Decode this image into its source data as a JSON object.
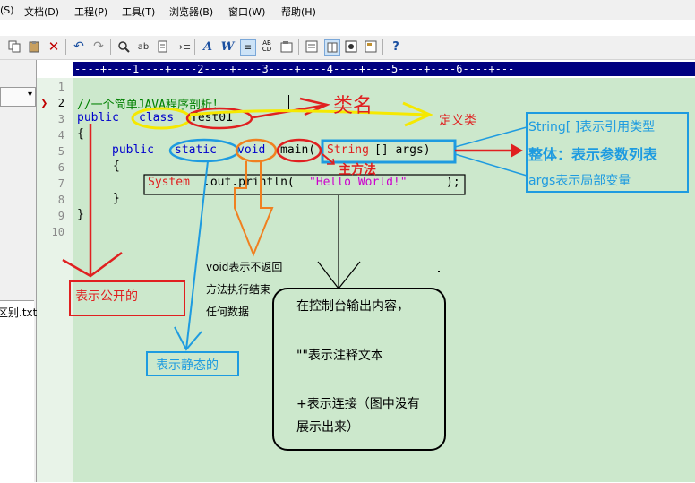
{
  "menu": {
    "items": [
      "(S)",
      "文档(D)",
      "工程(P)",
      "工具(T)",
      "浏览器(B)",
      "窗口(W)",
      "帮助(H)"
    ]
  },
  "toolbar": {
    "icons": [
      "copy-icon",
      "paste-icon",
      "delete-icon",
      "undo-icon",
      "redo-icon",
      "find-icon",
      "replace-icon",
      "find-in-files-icon",
      "indent-icon",
      "font-icon",
      "wordwrap-icon",
      "line-number-icon",
      "hex-icon",
      "settings-icon",
      "view-icon",
      "column-icon",
      "print-icon",
      "close-doc-icon",
      "help-icon"
    ]
  },
  "sidebar": {
    "file_item": "区别.txt"
  },
  "ruler": {
    "text": "----+----1----+----2----+----3----+----4----+----5----+----6----+---"
  },
  "editor": {
    "line_numbers": [
      "1",
      "2",
      "3",
      "4",
      "5",
      "6",
      "7",
      "8",
      "9",
      "10"
    ],
    "line2_comment": "//一个简单JAVA程序剖析！",
    "line3_public": "public",
    "line3_class": "class",
    "line3_name": "Test01",
    "line4": "{",
    "line5_public": "public",
    "line5_static": "static",
    "line5_void": "void",
    "line5_main": "main(",
    "line5_string": "String",
    "line5_args": "[] args)",
    "line6": "{",
    "line7_system": "System",
    "line7_out": ".out.println(",
    "line7_string": "\"Hello World!\"",
    "line7_end": ");",
    "line8": "}",
    "line9": "}"
  },
  "annotations": {
    "class_name": "类名",
    "define_class": "定义类",
    "main_method": "主方法",
    "string_array": "String[ ]表示引用类型",
    "param_list": "整体：表示参数列表",
    "args_local": "args表示局部变量",
    "void_desc": [
      "void表示不返回",
      "方法执行结束",
      "任何数据"
    ],
    "public_desc": "表示公开的",
    "static_desc": "表示静态的",
    "console_desc": [
      "在控制台输出内容，",
      "\"\"表示注释文本",
      "+表示连接（图中没有",
      "展示出来）"
    ]
  },
  "colors": {
    "editor_bg": "#cce8cc",
    "red": "#e02020",
    "yellow": "#f5e800",
    "blue": "#1e9be0",
    "orange": "#f08020"
  }
}
